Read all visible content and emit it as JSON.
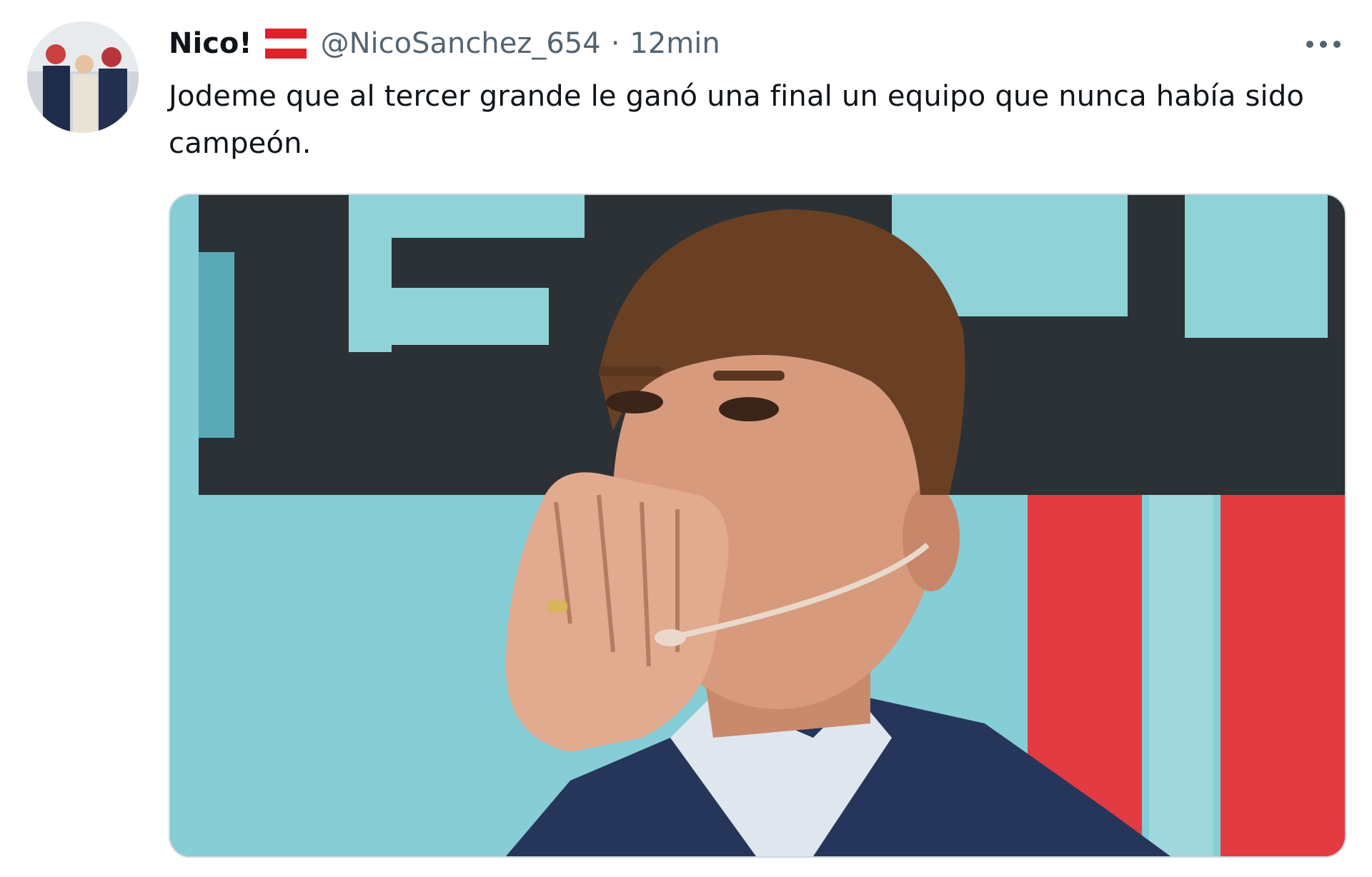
{
  "tweet": {
    "display_name": "Nico!",
    "handle": "@NicoSanchez_654",
    "separator": "·",
    "time": "12min",
    "text": "Jodeme que al tercer grande le ganó una final un equipo que nunca había sido campeón.",
    "flag_colors": [
      "#e0202a",
      "#ffffff",
      "#e0202a"
    ],
    "icons": {
      "more": "more-horizontal-icon"
    },
    "media_palette": {
      "background": "#86cdd6",
      "logo_dark": "#2b3135",
      "accent_red": "#e23b42",
      "suit": "#26365a",
      "hair": "#6a4024",
      "skin": "#d79a7c"
    }
  }
}
